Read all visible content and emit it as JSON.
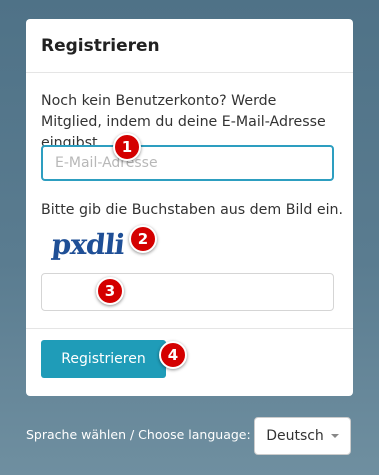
{
  "card": {
    "title": "Registrieren",
    "intro": "Noch kein Benutzerkonto? Werde Mitglied, indem du deine E-Mail-Adresse eingibst.",
    "email_placeholder": "E-Mail-Adresse",
    "email_value": "",
    "captcha_label": "Bitte gib die Buchstaben aus dem Bild ein.",
    "captcha_text": "pxdli",
    "captcha_input_value": "",
    "submit_label": "Registrieren"
  },
  "markers": [
    "1",
    "2",
    "3",
    "4"
  ],
  "footer": {
    "language_label": "Sprache wählen / Choose language:",
    "language_selected": "Deutsch"
  },
  "colors": {
    "accent": "#1f9cb8",
    "focus_border": "#2d9ec0",
    "marker": "#d40000"
  },
  "icons": [
    "caret-down-icon"
  ]
}
